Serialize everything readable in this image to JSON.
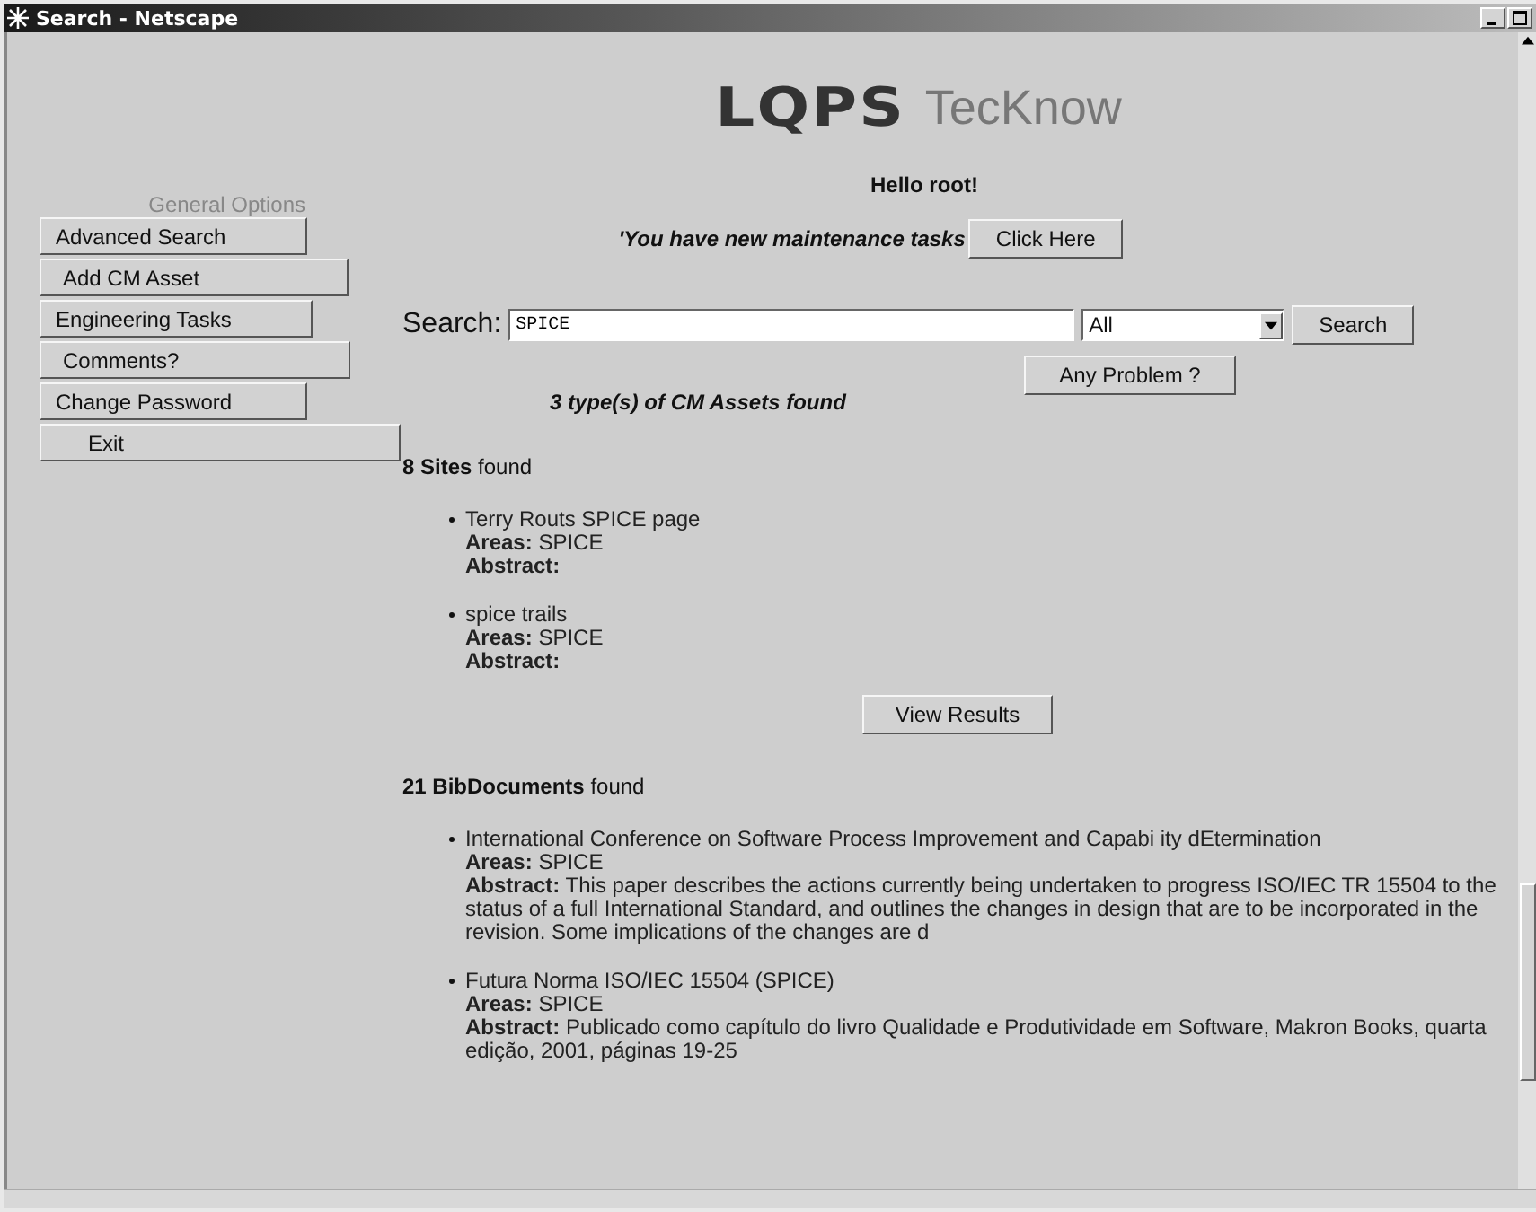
{
  "window": {
    "title": "Search - Netscape"
  },
  "logo": {
    "mark": "LQPS",
    "name": "TecKnow"
  },
  "greeting": "Hello root!",
  "sidebar": {
    "heading": "General Options",
    "buttons": [
      "Advanced Search",
      "Add CM Asset",
      "Engineering Tasks",
      "Comments?",
      "Change Password",
      "Exit"
    ]
  },
  "notice": {
    "text": "'You have new maintenance tasks",
    "button": "Click Here"
  },
  "search": {
    "label": "Search:",
    "value": "SPICE",
    "scope": "All",
    "button": "Search"
  },
  "problem_button": "Any Problem ?",
  "summary": "3 type(s) of CM Assets found",
  "sections": [
    {
      "heading": "**8 Sites** found",
      "button": "View Results",
      "items": [
        {
          "title": "Terry Routs SPICE page",
          "areas": "**Areas:** SPICE",
          "abstract": "**Abstract:**"
        },
        {
          "title": "spice trails",
          "areas": "**Areas:** SPICE",
          "abstract": "**Abstract:**"
        }
      ]
    },
    {
      "heading": "**21 BibDocuments** found",
      "items": [
        {
          "title": "International Conference on Software Process Improvement and Capabi ity dEtermination",
          "areas": "**Areas:** SPICE",
          "abstract": "**Abstract:** This paper describes the actions currently being undertaken to progress ISO/IEC TR 15504 to the status of a full International Standard, and outlines the changes in design that are to be incorporated in the revision. Some implications of the changes are d"
        },
        {
          "title": "Futura Norma ISO/IEC 15504 (SPICE)",
          "areas": "**Areas:** SPICE",
          "abstract": "**Abstract:** Publicado como capítulo do livro Qualidade e Produtividade em Software, Makron Books, quarta edição, 2001, páginas 19-25"
        }
      ]
    }
  ]
}
